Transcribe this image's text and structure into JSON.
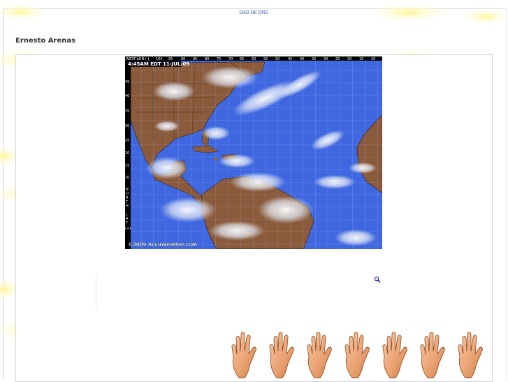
{
  "header": {
    "top_link": "DAO DE JING"
  },
  "blog": {
    "title": "Ernesto Arenas"
  },
  "weather_map": {
    "title": "4:45AM EDT 11-JUL-09",
    "lon_label": "WEST LON (-)",
    "lon_ticks": [
      "100",
      "95",
      "90",
      "85",
      "80",
      "75",
      "70",
      "65",
      "60",
      "55",
      "50",
      "45",
      "40",
      "35",
      "30",
      "25",
      "20",
      "15",
      "10"
    ],
    "lat_ticks": [
      "45",
      "40",
      "35",
      "30",
      "25",
      "20",
      "15",
      "10"
    ],
    "lat_letters": [
      "N",
      "O",
      "R",
      "T",
      "H",
      "",
      "L",
      "A",
      "T",
      "",
      "(+)"
    ],
    "copyright": "©2009 AccuWeather.com"
  },
  "decor": {
    "hands_count": 7,
    "zoom_icon": "magnifier-icon",
    "hand_icon": "waving-hand-icon"
  },
  "colors": {
    "link": "#2a3fb0",
    "title": "#333333",
    "ocean": "#3f68e0",
    "land": "#8a5a3a",
    "clouds": "#e8ecf4"
  }
}
